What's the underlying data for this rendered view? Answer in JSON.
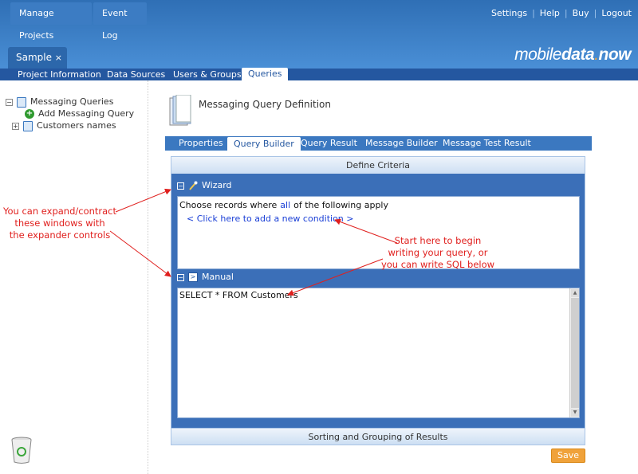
{
  "topbar": {
    "manage_projects": "Manage Projects",
    "event_log": "Event Log",
    "links": [
      "Settings",
      "Help",
      "Buy",
      "Logout"
    ],
    "logo_part1": "mobile",
    "logo_part2": "data",
    "logo_part3": "now"
  },
  "project_tab": {
    "label": "Sample",
    "close": "×"
  },
  "subnav": [
    "Project Information",
    "Data Sources",
    "Users & Groups",
    "Queries"
  ],
  "tree": {
    "root": "Messaging Queries",
    "add": "Add Messaging Query",
    "customers": "Customers names"
  },
  "page": {
    "title": "Messaging Query Definition"
  },
  "tabs": [
    "Properties",
    "Query Builder",
    "Query Result",
    "Message Builder",
    "Message Test Result"
  ],
  "criteria": {
    "header": "Define Criteria",
    "wizard_title": "Wizard",
    "choose_prefix": "Choose records where",
    "choose_all": "all",
    "choose_suffix": "of the following apply",
    "add_condition": "< Click here to add a new condition >",
    "manual_title": "Manual",
    "sql": "SELECT * FROM Customers"
  },
  "sorting": "Sorting and Grouping of Results",
  "save": "Save",
  "annotations": {
    "expand_line1": "You can expand/contract",
    "expand_line2": "these windows with",
    "expand_line3": "the expander controls",
    "start_line1": "Start here to begin",
    "start_line2": "writing your query, or",
    "start_line3": "you can write SQL below"
  },
  "colors": {
    "accent": "#3b78c0",
    "nav": "#2457a0",
    "save": "#f0a23a",
    "annotation": "#e0201e"
  }
}
